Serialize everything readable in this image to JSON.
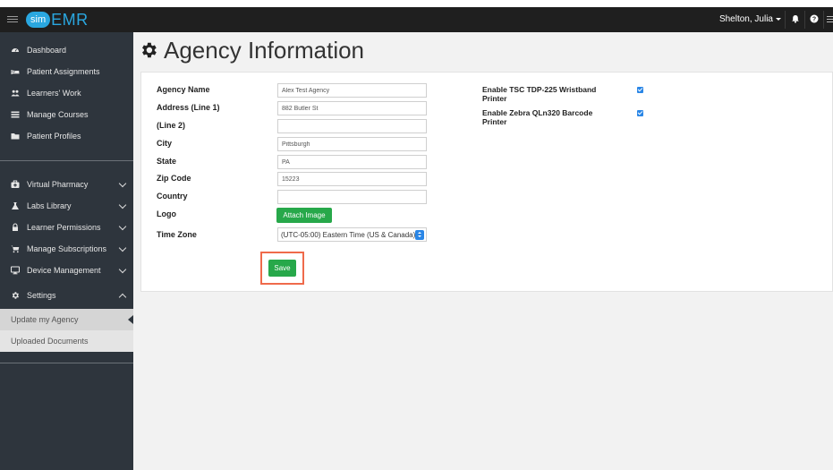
{
  "topbar": {
    "logo_pill": "sim",
    "logo_text": "EMR",
    "user_name": "Shelton, Julia",
    "icons": [
      "menu-icon",
      "bell-icon",
      "help-icon",
      "menu-icon"
    ]
  },
  "sidebar": {
    "items": [
      {
        "label": "Dashboard",
        "icon": "dashboard-icon"
      },
      {
        "label": "Patient Assignments",
        "icon": "bed-icon"
      },
      {
        "label": "Learners' Work",
        "icon": "users-icon"
      },
      {
        "label": "Manage Courses",
        "icon": "list-icon"
      },
      {
        "label": "Patient Profiles",
        "icon": "folder-icon"
      },
      {
        "label": "Virtual Pharmacy",
        "icon": "medkit-icon"
      },
      {
        "label": "Labs Library",
        "icon": "flask-icon"
      },
      {
        "label": "Learner Permissions",
        "icon": "lock-icon"
      },
      {
        "label": "Manage Subscriptions",
        "icon": "cart-icon"
      },
      {
        "label": "Device Management",
        "icon": "desktop-icon"
      },
      {
        "label": "Settings",
        "icon": "gear-icon"
      }
    ],
    "sub_items": [
      {
        "label": "Update my Agency"
      },
      {
        "label": "Uploaded Documents"
      }
    ]
  },
  "page": {
    "title": "Agency Information"
  },
  "form": {
    "labels": {
      "agency_name": "Agency Name",
      "address1": "Address (Line 1)",
      "address2": "(Line 2)",
      "city": "City",
      "state": "State",
      "zip": "Zip Code",
      "country": "Country",
      "logo": "Logo",
      "timezone": "Time Zone"
    },
    "values": {
      "agency_name": "Alex Test Agency",
      "address1": "882 Butler St",
      "address2": "",
      "city": "Pittsburgh",
      "state": "PA",
      "zip": "15223",
      "country": ""
    },
    "attach_label": "Attach Image",
    "timezone_value": "(UTC-05:00) Eastern Time (US & Canada)",
    "save_label": "Save",
    "options": [
      {
        "label": "Enable TSC TDP-225 Wristband Printer",
        "checked": true
      },
      {
        "label": "Enable Zebra QLn320 Barcode Printer",
        "checked": true
      }
    ]
  },
  "colors": {
    "accent": "#2aa7e0",
    "sidebar": "#2e353d",
    "button_green": "#27a84a",
    "highlight": "#ef6a4b"
  }
}
